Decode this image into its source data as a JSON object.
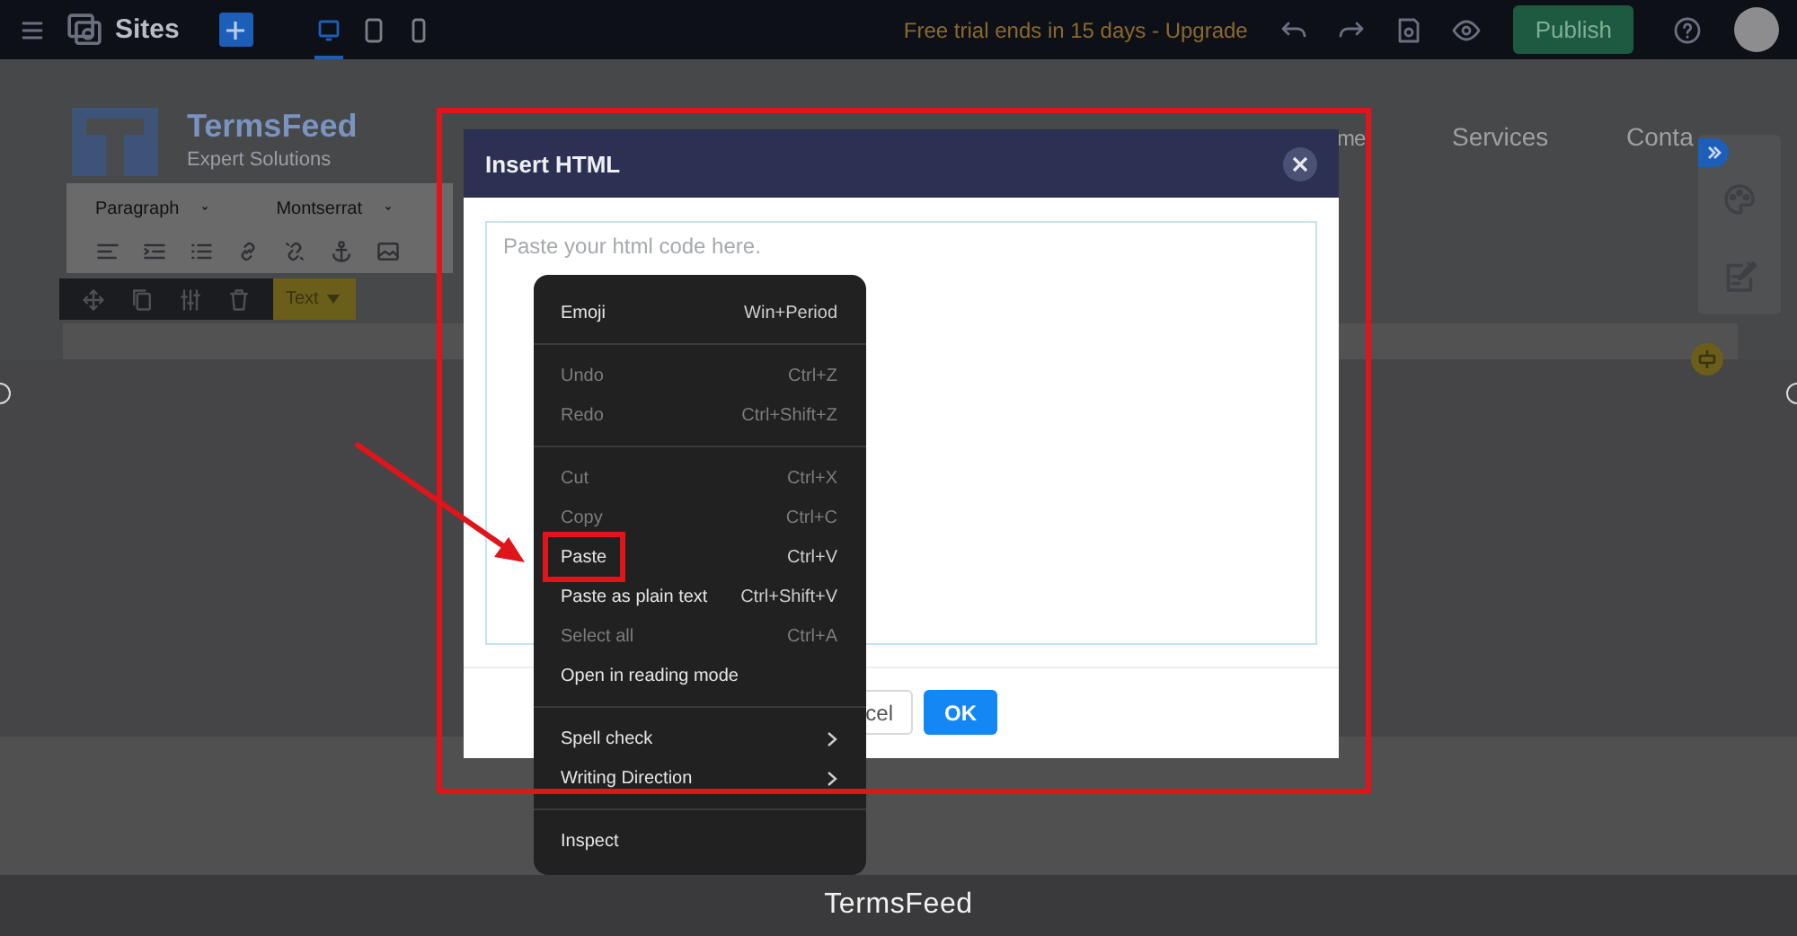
{
  "topbar": {
    "app_name": "Sites",
    "devices": [
      {
        "kind": "desktop",
        "selected": true
      },
      {
        "kind": "tablet",
        "selected": false
      },
      {
        "kind": "phone",
        "selected": false
      }
    ],
    "trial_notice": "Free trial ends in 15 days - Upgrade",
    "publish": "Publish"
  },
  "site": {
    "brand": "TermsFeed",
    "tagline": "Expert Solutions",
    "nav": [
      "me",
      "Services",
      "Conta"
    ]
  },
  "text_toolbar": {
    "block_format": "Paragraph",
    "font": "Montserrat"
  },
  "block_toolbar": {
    "tag": "Text"
  },
  "dialog": {
    "title": "Insert HTML",
    "placeholder": "Paste your html code here.",
    "buttons": [
      {
        "label": "cel",
        "kind": "secondary"
      },
      {
        "label": "OK",
        "kind": "primary"
      }
    ]
  },
  "context_menu": {
    "groups": [
      [
        {
          "label": "Emoji",
          "shortcut": "Win+Period",
          "disabled": false,
          "submenu": false,
          "highlighted": false
        }
      ],
      [
        {
          "label": "Undo",
          "shortcut": "Ctrl+Z",
          "disabled": true,
          "submenu": false,
          "highlighted": false
        },
        {
          "label": "Redo",
          "shortcut": "Ctrl+Shift+Z",
          "disabled": true,
          "submenu": false,
          "highlighted": false
        }
      ],
      [
        {
          "label": "Cut",
          "shortcut": "Ctrl+X",
          "disabled": true,
          "submenu": false,
          "highlighted": false
        },
        {
          "label": "Copy",
          "shortcut": "Ctrl+C",
          "disabled": true,
          "submenu": false,
          "highlighted": false
        },
        {
          "label": "Paste",
          "shortcut": "Ctrl+V",
          "disabled": false,
          "submenu": false,
          "highlighted": true
        },
        {
          "label": "Paste as plain text",
          "shortcut": "Ctrl+Shift+V",
          "disabled": false,
          "submenu": false,
          "highlighted": false
        },
        {
          "label": "Select all",
          "shortcut": "Ctrl+A",
          "disabled": true,
          "submenu": false,
          "highlighted": false
        },
        {
          "label": "Open in reading mode",
          "disabled": false,
          "submenu": false,
          "highlighted": false
        }
      ],
      [
        {
          "label": "Spell check",
          "disabled": false,
          "submenu": true,
          "highlighted": false
        },
        {
          "label": "Writing Direction",
          "disabled": false,
          "submenu": true,
          "highlighted": false
        }
      ],
      [
        {
          "label": "Inspect",
          "disabled": false,
          "submenu": false,
          "highlighted": false
        }
      ]
    ]
  },
  "caption": "TermsFeed"
}
